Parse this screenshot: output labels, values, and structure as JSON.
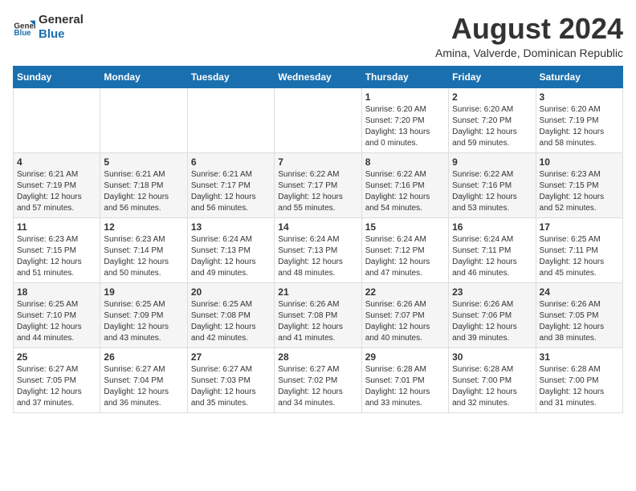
{
  "logo": {
    "text_general": "General",
    "text_blue": "Blue"
  },
  "title": {
    "month_year": "August 2024",
    "location": "Amina, Valverde, Dominican Republic"
  },
  "weekdays": [
    "Sunday",
    "Monday",
    "Tuesday",
    "Wednesday",
    "Thursday",
    "Friday",
    "Saturday"
  ],
  "weeks": [
    [
      {
        "day": "",
        "sunrise": "",
        "sunset": "",
        "daylight": ""
      },
      {
        "day": "",
        "sunrise": "",
        "sunset": "",
        "daylight": ""
      },
      {
        "day": "",
        "sunrise": "",
        "sunset": "",
        "daylight": ""
      },
      {
        "day": "",
        "sunrise": "",
        "sunset": "",
        "daylight": ""
      },
      {
        "day": "1",
        "sunrise": "Sunrise: 6:20 AM",
        "sunset": "Sunset: 7:20 PM",
        "daylight": "Daylight: 13 hours and 0 minutes."
      },
      {
        "day": "2",
        "sunrise": "Sunrise: 6:20 AM",
        "sunset": "Sunset: 7:20 PM",
        "daylight": "Daylight: 12 hours and 59 minutes."
      },
      {
        "day": "3",
        "sunrise": "Sunrise: 6:20 AM",
        "sunset": "Sunset: 7:19 PM",
        "daylight": "Daylight: 12 hours and 58 minutes."
      }
    ],
    [
      {
        "day": "4",
        "sunrise": "Sunrise: 6:21 AM",
        "sunset": "Sunset: 7:19 PM",
        "daylight": "Daylight: 12 hours and 57 minutes."
      },
      {
        "day": "5",
        "sunrise": "Sunrise: 6:21 AM",
        "sunset": "Sunset: 7:18 PM",
        "daylight": "Daylight: 12 hours and 56 minutes."
      },
      {
        "day": "6",
        "sunrise": "Sunrise: 6:21 AM",
        "sunset": "Sunset: 7:17 PM",
        "daylight": "Daylight: 12 hours and 56 minutes."
      },
      {
        "day": "7",
        "sunrise": "Sunrise: 6:22 AM",
        "sunset": "Sunset: 7:17 PM",
        "daylight": "Daylight: 12 hours and 55 minutes."
      },
      {
        "day": "8",
        "sunrise": "Sunrise: 6:22 AM",
        "sunset": "Sunset: 7:16 PM",
        "daylight": "Daylight: 12 hours and 54 minutes."
      },
      {
        "day": "9",
        "sunrise": "Sunrise: 6:22 AM",
        "sunset": "Sunset: 7:16 PM",
        "daylight": "Daylight: 12 hours and 53 minutes."
      },
      {
        "day": "10",
        "sunrise": "Sunrise: 6:23 AM",
        "sunset": "Sunset: 7:15 PM",
        "daylight": "Daylight: 12 hours and 52 minutes."
      }
    ],
    [
      {
        "day": "11",
        "sunrise": "Sunrise: 6:23 AM",
        "sunset": "Sunset: 7:15 PM",
        "daylight": "Daylight: 12 hours and 51 minutes."
      },
      {
        "day": "12",
        "sunrise": "Sunrise: 6:23 AM",
        "sunset": "Sunset: 7:14 PM",
        "daylight": "Daylight: 12 hours and 50 minutes."
      },
      {
        "day": "13",
        "sunrise": "Sunrise: 6:24 AM",
        "sunset": "Sunset: 7:13 PM",
        "daylight": "Daylight: 12 hours and 49 minutes."
      },
      {
        "day": "14",
        "sunrise": "Sunrise: 6:24 AM",
        "sunset": "Sunset: 7:13 PM",
        "daylight": "Daylight: 12 hours and 48 minutes."
      },
      {
        "day": "15",
        "sunrise": "Sunrise: 6:24 AM",
        "sunset": "Sunset: 7:12 PM",
        "daylight": "Daylight: 12 hours and 47 minutes."
      },
      {
        "day": "16",
        "sunrise": "Sunrise: 6:24 AM",
        "sunset": "Sunset: 7:11 PM",
        "daylight": "Daylight: 12 hours and 46 minutes."
      },
      {
        "day": "17",
        "sunrise": "Sunrise: 6:25 AM",
        "sunset": "Sunset: 7:11 PM",
        "daylight": "Daylight: 12 hours and 45 minutes."
      }
    ],
    [
      {
        "day": "18",
        "sunrise": "Sunrise: 6:25 AM",
        "sunset": "Sunset: 7:10 PM",
        "daylight": "Daylight: 12 hours and 44 minutes."
      },
      {
        "day": "19",
        "sunrise": "Sunrise: 6:25 AM",
        "sunset": "Sunset: 7:09 PM",
        "daylight": "Daylight: 12 hours and 43 minutes."
      },
      {
        "day": "20",
        "sunrise": "Sunrise: 6:25 AM",
        "sunset": "Sunset: 7:08 PM",
        "daylight": "Daylight: 12 hours and 42 minutes."
      },
      {
        "day": "21",
        "sunrise": "Sunrise: 6:26 AM",
        "sunset": "Sunset: 7:08 PM",
        "daylight": "Daylight: 12 hours and 41 minutes."
      },
      {
        "day": "22",
        "sunrise": "Sunrise: 6:26 AM",
        "sunset": "Sunset: 7:07 PM",
        "daylight": "Daylight: 12 hours and 40 minutes."
      },
      {
        "day": "23",
        "sunrise": "Sunrise: 6:26 AM",
        "sunset": "Sunset: 7:06 PM",
        "daylight": "Daylight: 12 hours and 39 minutes."
      },
      {
        "day": "24",
        "sunrise": "Sunrise: 6:26 AM",
        "sunset": "Sunset: 7:05 PM",
        "daylight": "Daylight: 12 hours and 38 minutes."
      }
    ],
    [
      {
        "day": "25",
        "sunrise": "Sunrise: 6:27 AM",
        "sunset": "Sunset: 7:05 PM",
        "daylight": "Daylight: 12 hours and 37 minutes."
      },
      {
        "day": "26",
        "sunrise": "Sunrise: 6:27 AM",
        "sunset": "Sunset: 7:04 PM",
        "daylight": "Daylight: 12 hours and 36 minutes."
      },
      {
        "day": "27",
        "sunrise": "Sunrise: 6:27 AM",
        "sunset": "Sunset: 7:03 PM",
        "daylight": "Daylight: 12 hours and 35 minutes."
      },
      {
        "day": "28",
        "sunrise": "Sunrise: 6:27 AM",
        "sunset": "Sunset: 7:02 PM",
        "daylight": "Daylight: 12 hours and 34 minutes."
      },
      {
        "day": "29",
        "sunrise": "Sunrise: 6:28 AM",
        "sunset": "Sunset: 7:01 PM",
        "daylight": "Daylight: 12 hours and 33 minutes."
      },
      {
        "day": "30",
        "sunrise": "Sunrise: 6:28 AM",
        "sunset": "Sunset: 7:00 PM",
        "daylight": "Daylight: 12 hours and 32 minutes."
      },
      {
        "day": "31",
        "sunrise": "Sunrise: 6:28 AM",
        "sunset": "Sunset: 7:00 PM",
        "daylight": "Daylight: 12 hours and 31 minutes."
      }
    ]
  ]
}
